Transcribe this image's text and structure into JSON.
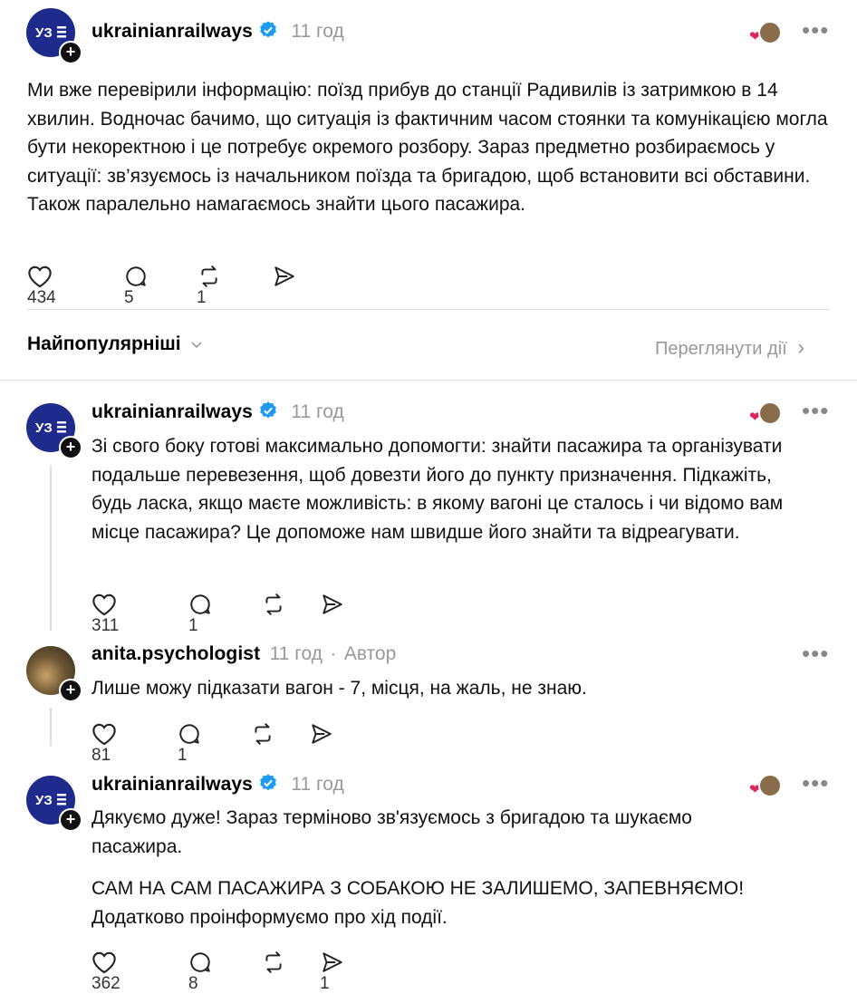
{
  "post": {
    "username": "ukrainianrailways",
    "time": "11 год",
    "text": "Ми вже перевірили інформацію: поїзд прибув до станції Радивилів із затримкою в 14 хвилин. Водночас бачимо, що ситуація із фактичним часом стоянки та комунікацією могла бути некоректною і це потребує окремого розбору. Зараз предметно розбираємось у ситуації: зв’язуємось із начальником поїзда та бригадою, щоб встановити всі обставини. Також паралельно намагаємось знайти цього пасажира.",
    "likes": "434",
    "comments": "5",
    "reposts": "1"
  },
  "sort_bar": {
    "sort_label": "Найпопулярніші",
    "activity_link": "Переглянути дії"
  },
  "replies": [
    {
      "username": "ukrainianrailways",
      "time": "11 год",
      "text": "Зі свого боку готові максимально допомогти: знайти пасажира та організувати подальше перевезення, щоб довезти його до пункту призначення. Підкажіть, будь ласка, якщо маєте можливість: в якому вагоні це сталось і чи відомо вам місце пасажира? Це допоможе нам швидше його знайти та відреагувати.",
      "likes": "311",
      "comments": "1"
    },
    {
      "username": "anita.psychologist",
      "time": "11 год",
      "separator": "·",
      "author_tag": "Автор",
      "text": "Лише можу підказати вагон - 7, місця, на жаль, не знаю.",
      "likes": "81",
      "comments": "1"
    },
    {
      "username": "ukrainianrailways",
      "time": "11 год",
      "text1": "Дякуємо дуже! Зараз терміново зв'язуємось з бригадою та шукаємо пасажира.",
      "text2": "САМ НА САМ ПАСАЖИРА З СОБАКОЮ НЕ ЗАЛИШЕМО, ЗАПЕВНЯЄМО! Додатково проінформуємо про хід події.",
      "likes": "362",
      "comments": "8",
      "shares": "1"
    }
  ],
  "icons": {
    "more": "•••",
    "plus": "+",
    "chevron": "›"
  },
  "colors": {
    "avatar_brand": "#1e2a8c",
    "verified": "#1d9bf0",
    "muted": "#999999"
  }
}
